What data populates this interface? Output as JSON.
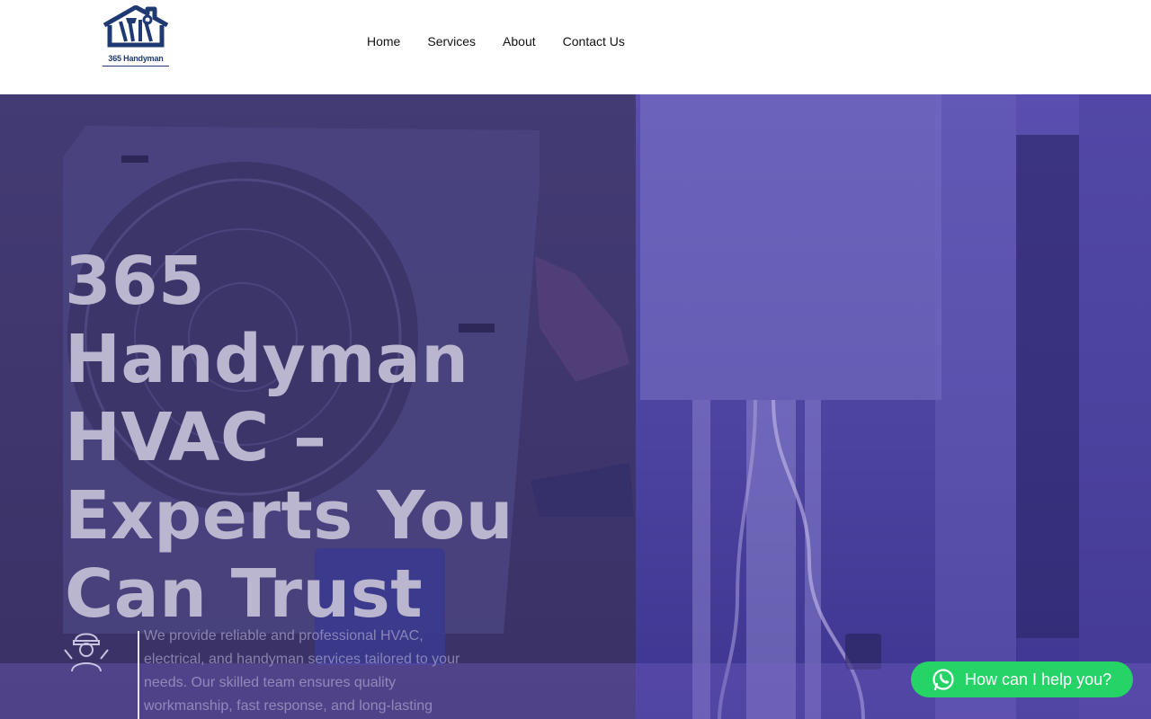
{
  "header": {
    "logo_text": "365 Handyman",
    "nav": [
      {
        "label": "Home"
      },
      {
        "label": "Services"
      },
      {
        "label": "About"
      },
      {
        "label": "Contact Us"
      }
    ]
  },
  "hero": {
    "title": "365 Handyman HVAC – Experts You Can Trust",
    "description": "We provide reliable and professional HVAC, electrical, and handyman services tailored to your needs. Our skilled team ensures quality workmanship, fast response, and long-lasting"
  },
  "whatsapp": {
    "label": "How can I help you?",
    "icon": "whatsapp-icon",
    "color": "#26d367"
  },
  "colors": {
    "brand": "#1f3a73",
    "hero_overlay": "#3e3474"
  }
}
